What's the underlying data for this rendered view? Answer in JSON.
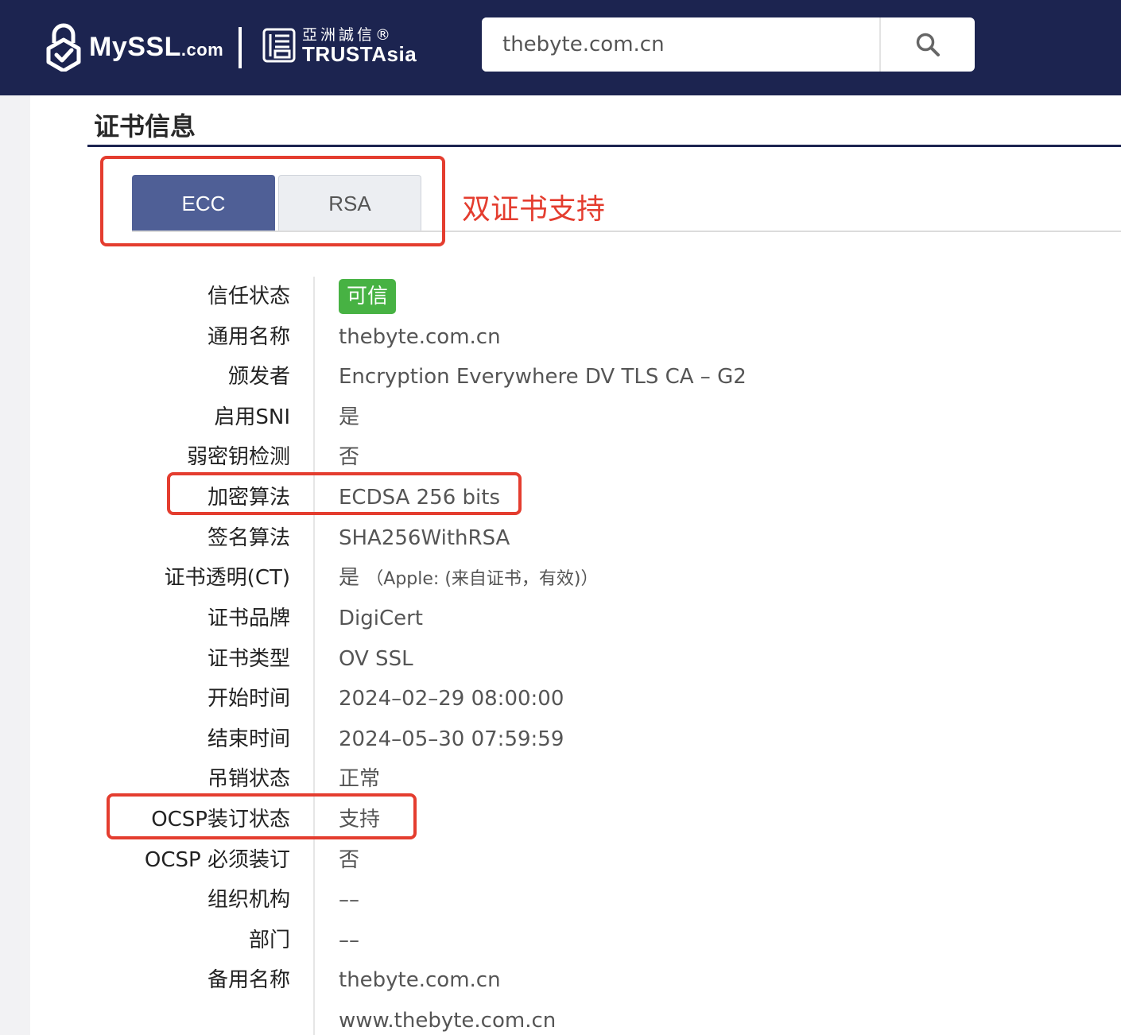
{
  "header": {
    "brand": "MySSL",
    "brand_suffix": ".com",
    "partner_cn": "亞洲誠信®",
    "partner_en": "TRUSTAsia",
    "search_value": "thebyte.com.cn",
    "colors": {
      "header_bg": "#1c2450"
    }
  },
  "section": {
    "title": "证书信息",
    "tabs": [
      {
        "label": "ECC",
        "active": true
      },
      {
        "label": "RSA",
        "active": false
      }
    ],
    "annotation": "双证书支持"
  },
  "cert": {
    "trust_status": {
      "label": "信任状态",
      "value": "可信"
    },
    "common_name": {
      "label": "通用名称",
      "value": "thebyte.com.cn"
    },
    "issuer": {
      "label": "颁发者",
      "value": "Encryption Everywhere DV TLS CA – G2"
    },
    "sni": {
      "label": "启用SNI",
      "value": "是"
    },
    "weak_key": {
      "label": "弱密钥检测",
      "value": "否"
    },
    "encryption": {
      "label": "加密算法",
      "value": "ECDSA 256 bits"
    },
    "signature": {
      "label": "签名算法",
      "value": "SHA256WithRSA"
    },
    "ct": {
      "label": "证书透明(CT)",
      "value": "是",
      "detail": "（Apple: (来自证书，有效)）"
    },
    "brand": {
      "label": "证书品牌",
      "value": "DigiCert"
    },
    "type": {
      "label": "证书类型",
      "value": "OV SSL"
    },
    "start": {
      "label": "开始时间",
      "value": "2024–02–29 08:00:00"
    },
    "end": {
      "label": "结束时间",
      "value": "2024–05–30 07:59:59"
    },
    "revocation": {
      "label": "吊销状态",
      "value": "正常"
    },
    "ocsp_stapling": {
      "label": "OCSP装订状态",
      "value": "支持"
    },
    "ocsp_must_staple": {
      "label": "OCSP 必须装订",
      "value": "否"
    },
    "org": {
      "label": "组织机构",
      "value": "––"
    },
    "dept": {
      "label": "部门",
      "value": "––"
    },
    "san": {
      "label": "备用名称",
      "values": [
        "thebyte.com.cn",
        "www.thebyte.com.cn"
      ]
    }
  }
}
